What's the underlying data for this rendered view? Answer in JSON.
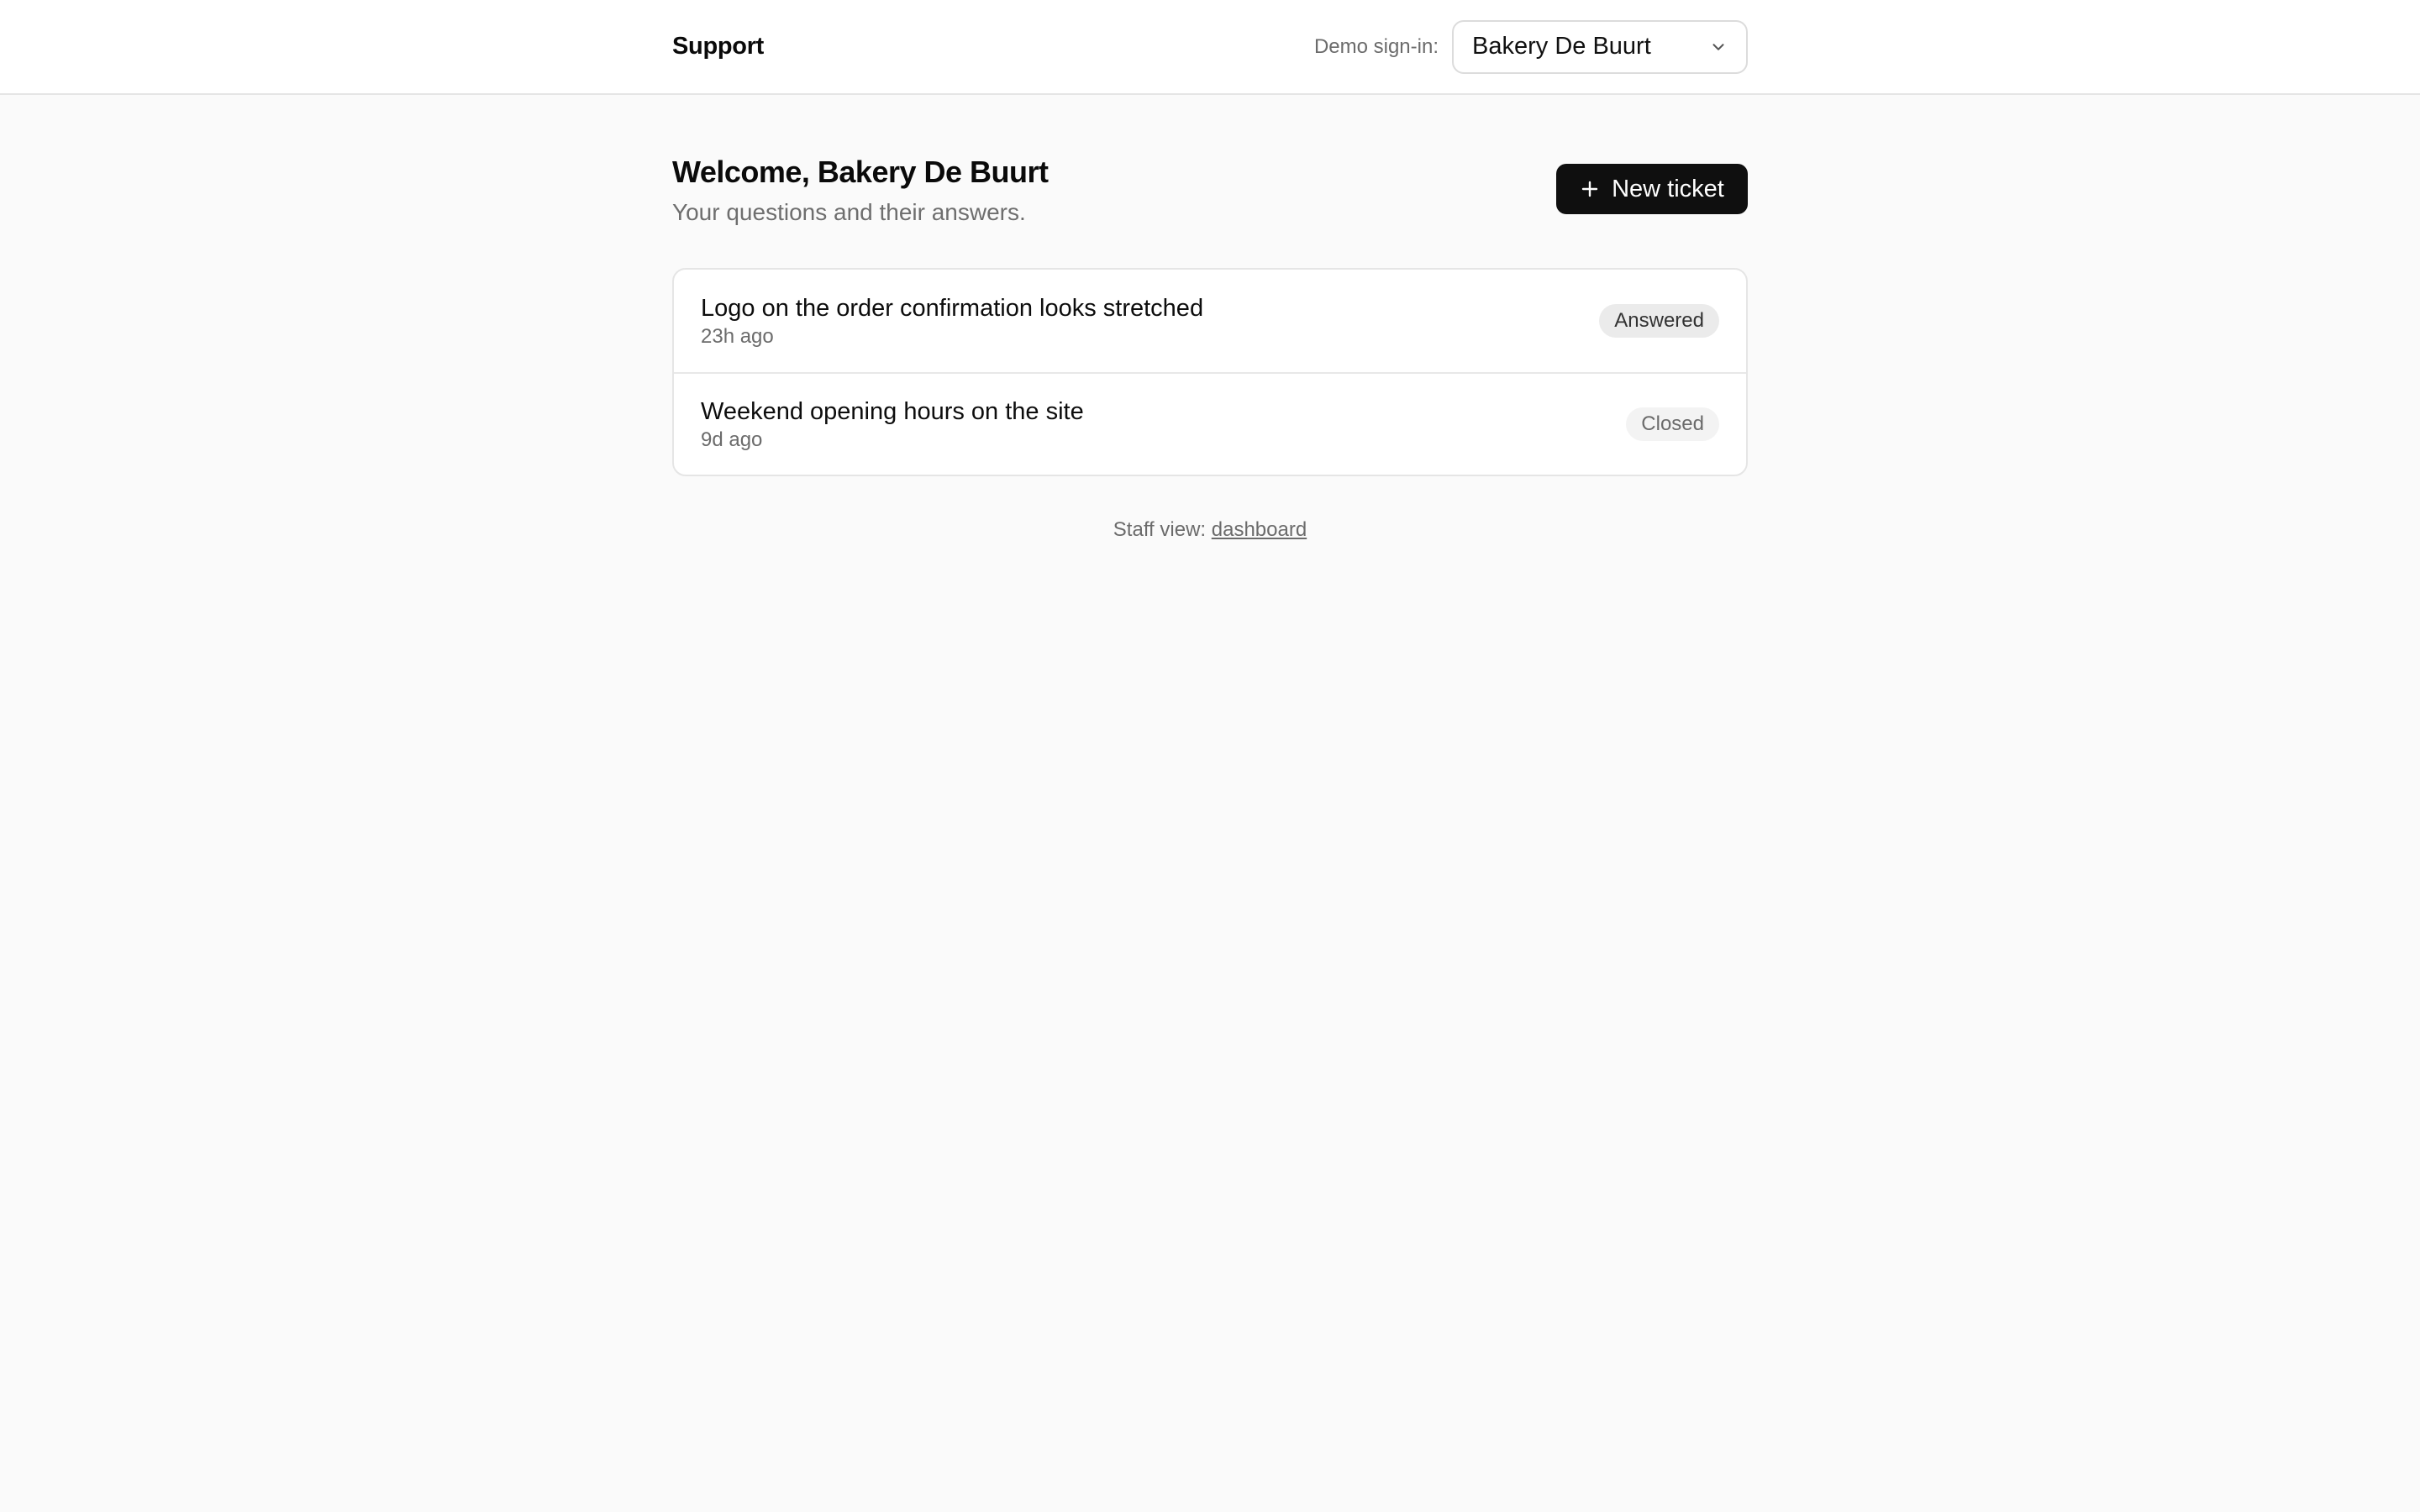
{
  "header": {
    "brand": "Support",
    "signin_label": "Demo sign-in:",
    "signin_selected": "Bakery De Buurt",
    "signin_icon": "chevron-down-icon"
  },
  "page": {
    "title": "Welcome, Bakery De Buurt",
    "subtitle": "Your questions and their answers.",
    "new_ticket_label": "New ticket",
    "new_ticket_icon": "plus-icon"
  },
  "tickets": [
    {
      "title": "Logo on the order confirmation looks stretched",
      "time": "23h ago",
      "status": "Answered"
    },
    {
      "title": "Weekend opening hours on the site",
      "time": "9d ago",
      "status": "Closed"
    }
  ],
  "footer": {
    "prefix": "Staff view:",
    "link": "dashboard"
  },
  "colors": {
    "background": "#fafafa",
    "primary_button": "#0f0f0f",
    "badge_answered": "#ebebeb",
    "badge_closed": "#f3f3f3"
  }
}
